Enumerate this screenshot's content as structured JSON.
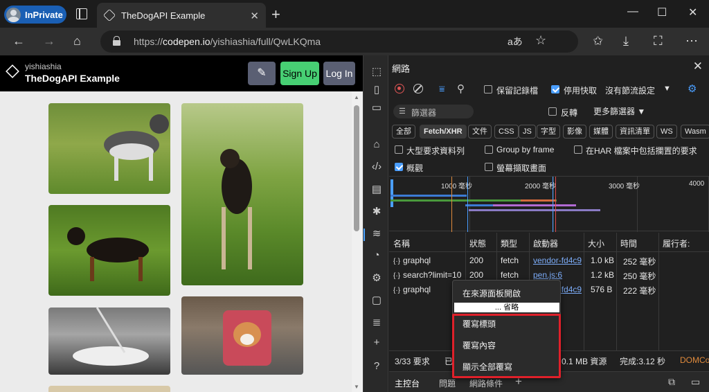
{
  "browser": {
    "profile_label": "InPrivate",
    "tab_title": "TheDogAPI Example",
    "url_prefix": "https://",
    "url_domain": "codepen.io",
    "url_path": "/yishiashia/full/QwLKQma"
  },
  "page": {
    "user": "yishiashia",
    "title": "TheDogAPI Example",
    "signup_label": "Sign Up",
    "login_label": "Log In"
  },
  "devtools": {
    "panel_title": "網路",
    "toolbar": {
      "preserve_log": "保留記錄檔",
      "disable_cache": "停用快取",
      "throttling": "沒有節流設定"
    },
    "filter": {
      "placeholder": "篩選器",
      "invert": "反轉",
      "more_filters": "更多篩選器"
    },
    "chips": [
      "全部",
      "Fetch/XHR",
      "文件",
      "CSS",
      "JS",
      "字型",
      "影像",
      "媒體",
      "資訊清單",
      "WS",
      "Wasm"
    ],
    "options": {
      "big_rows": "大型要求資料列",
      "group_by_frame": "Group by frame",
      "har_sensitive": "在HAR 檔案中包括攔置的要求",
      "overview": "概觀",
      "screenshots": "螢幕擷取畫面"
    },
    "timeline_labels": [
      "1000 毫秒",
      "2000 毫秒",
      "3000 毫秒",
      "4000"
    ],
    "columns": [
      "名稱",
      "狀態",
      "類型",
      "啟動器",
      "大小",
      "時間",
      "履行者:"
    ],
    "rows": [
      {
        "name": "graphql",
        "status": "200",
        "type": "fetch",
        "initiator": "vendor-fd4c9",
        "size": "1.0 kB",
        "time": "252 毫秒"
      },
      {
        "name": "search?limit=10",
        "status": "200",
        "type": "fetch",
        "initiator": "pen.js:6",
        "size": "1.2 kB",
        "time": "250 毫秒"
      },
      {
        "name": "graphql",
        "status": "",
        "type": "",
        "initiator": "vendor-fd4c9",
        "size": "576 B",
        "time": "222 毫秒"
      }
    ],
    "status": {
      "requests": "3/33 要求",
      "transferred_prefix": "已",
      "resources": "0.1 MB 資源",
      "finish": "完成:3.12 秒",
      "domcontent": "DOMCo"
    },
    "bottom_tabs": [
      "主控台",
      "問題",
      "網路條件"
    ]
  },
  "context_menu": {
    "open_in_sources": "在來源面板開啟",
    "ellipsis": "... 省略",
    "cover_header": "覆寫標頭",
    "cover_content": "覆寫內容",
    "show_all_overrides": "顯示全部覆寫"
  }
}
